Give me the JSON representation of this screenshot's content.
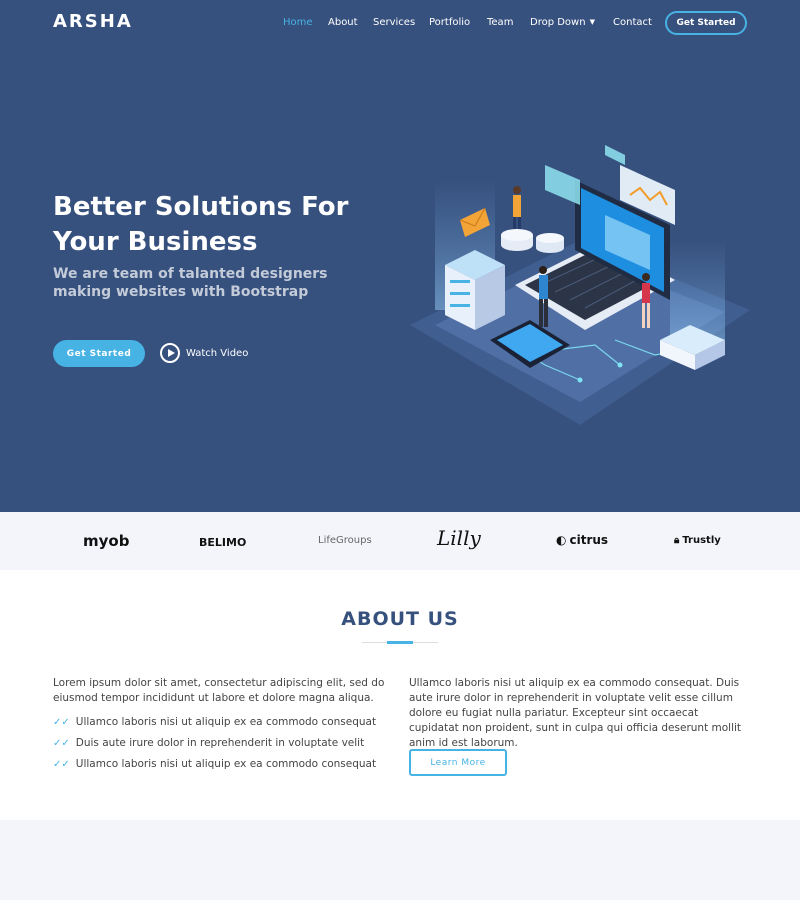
{
  "brand": "ARSHA",
  "nav": {
    "items": [
      {
        "label": "Home"
      },
      {
        "label": "About"
      },
      {
        "label": "Services"
      },
      {
        "label": "Portfolio"
      },
      {
        "label": "Team"
      },
      {
        "label": "Drop Down"
      },
      {
        "label": "Contact"
      }
    ],
    "active": "Home",
    "cta": "Get Started"
  },
  "hero": {
    "title": "Better Solutions For Your Business",
    "subtitle": "We are team of talanted designers making websites with Bootstrap",
    "primary_button": "Get Started",
    "video_link": "Watch Video"
  },
  "clients": [
    "myob",
    "BELIMO",
    "LifeGroups",
    "Lilly",
    "citrus",
    "Trustly"
  ],
  "about": {
    "title": "ABOUT US",
    "left_text": "Lorem ipsum dolor sit amet, consectetur adipiscing elit, sed do eiusmod tempor incididunt ut labore et dolore magna aliqua.",
    "checks": [
      "Ullamco laboris nisi ut aliquip ex ea commodo consequat",
      "Duis aute irure dolor in reprehenderit in voluptate velit",
      "Ullamco laboris nisi ut aliquip ex ea commodo consequat"
    ],
    "right_text": "Ullamco laboris nisi ut aliquip ex ea commodo consequat. Duis aute irure dolor in reprehenderit in voluptate velit esse cillum dolore eu fugiat nulla pariatur. Excepteur sint occaecat cupidatat non proident, sunt in culpa qui officia deserunt mollit anim id est laborum.",
    "button": "Learn More"
  },
  "colors": {
    "hero_bg": "#37517e",
    "accent": "#47b2e4",
    "clients_bg": "#f3f5fa"
  }
}
